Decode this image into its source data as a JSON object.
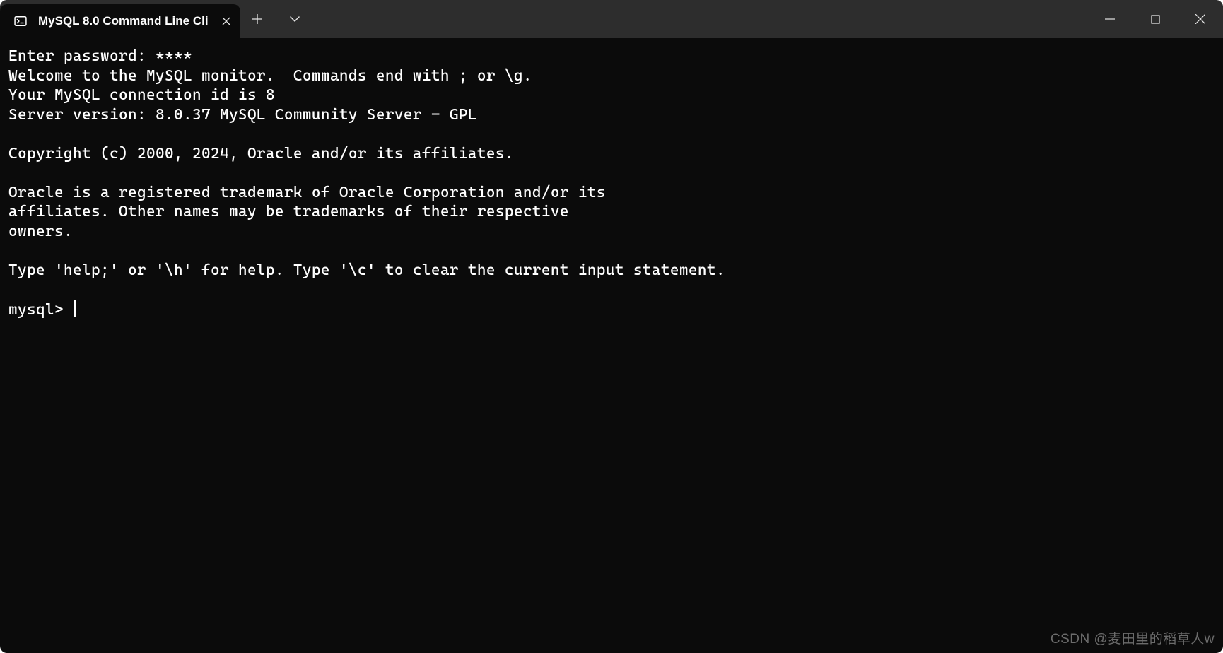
{
  "tab": {
    "title": "MySQL 8.0 Command Line Cli",
    "icon_name": "terminal-app-icon"
  },
  "titlebar_buttons": {
    "close_tab": "close-icon",
    "new_tab": "plus-icon",
    "tab_dropdown": "chevron-down-icon",
    "minimize": "minimize-icon",
    "maximize": "maximize-icon",
    "window_close": "close-icon"
  },
  "terminal": {
    "lines": [
      "Enter password: ****",
      "Welcome to the MySQL monitor.  Commands end with ; or \\g.",
      "Your MySQL connection id is 8",
      "Server version: 8.0.37 MySQL Community Server - GPL",
      "",
      "Copyright (c) 2000, 2024, Oracle and/or its affiliates.",
      "",
      "Oracle is a registered trademark of Oracle Corporation and/or its",
      "affiliates. Other names may be trademarks of their respective",
      "owners.",
      "",
      "Type 'help;' or '\\h' for help. Type '\\c' to clear the current input statement.",
      ""
    ],
    "prompt": "mysql> "
  },
  "watermark": "CSDN @麦田里的稻草人w"
}
